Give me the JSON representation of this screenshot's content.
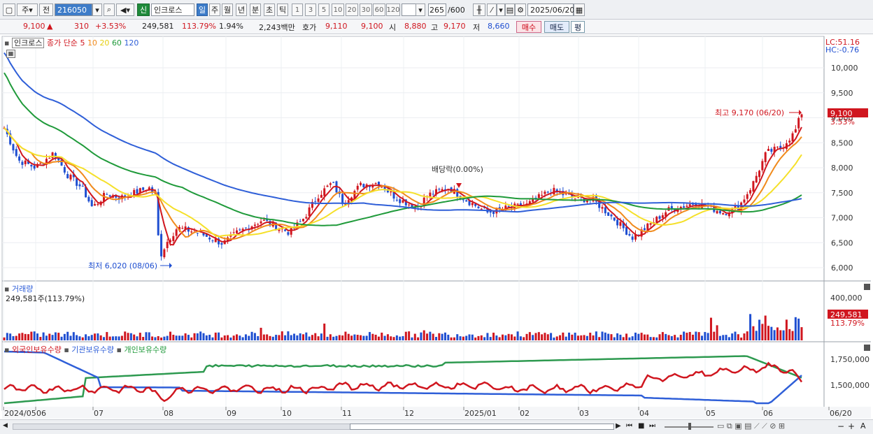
{
  "toolbar": {
    "mode1": "주",
    "mode2": "전",
    "code": "216050",
    "badge": "신",
    "name": "인크로스",
    "periods": [
      "일",
      "주",
      "월",
      "년",
      "분",
      "초",
      "틱"
    ],
    "nums": [
      "1",
      "3",
      "5",
      "10",
      "20",
      "30",
      "60",
      "120"
    ],
    "count": "265",
    "count_total": "/600",
    "date": "2025/06/20"
  },
  "info": {
    "price": "9,100",
    "arrow": "▲",
    "change": "310",
    "change_pct": "+3.53%",
    "volume": "249,581",
    "vol_ratio": "113.79%",
    "turnover": "1.94%",
    "amount": "2,243백만",
    "bid_label": "호가",
    "bid": "9,110",
    "ask": "9,100",
    "open_label": "시",
    "open": "8,880",
    "high_label": "고",
    "high": "9,170",
    "low_label": "저",
    "low": "8,660",
    "buy": "매수",
    "sell": "매도",
    "eval": "평"
  },
  "price_panel": {
    "title": "인크로스",
    "ma_label": "종가 단순",
    "ma": [
      "5",
      "10",
      "20",
      "60",
      "120"
    ],
    "lc": "LC:51.16",
    "hc": "HC:-0.76",
    "yticks": [
      "10,000",
      "9,500",
      "9,000",
      "8,500",
      "8,000",
      "7,500",
      "7,000",
      "6,500",
      "6,000"
    ],
    "current_price": "9,100",
    "current_pct": "3.53%",
    "high_note": "최고 9,170 (06/20)",
    "low_note": "최저 6,020 (08/06)",
    "dividend_note": "배당락(0.00%)"
  },
  "volume_panel": {
    "title": "거래량",
    "value": "249,581주(113.79%)",
    "ytick": "400,000",
    "current": "249,581",
    "current_pct": "113.79%"
  },
  "holding_panel": {
    "series": [
      "외국인보유수량",
      "기관보유수량",
      "개인보유수량"
    ],
    "yticks": [
      "1,750,000",
      "1,500,000"
    ]
  },
  "xaxis": [
    "2024/05",
    "06",
    "07",
    "08",
    "09",
    "10",
    "11",
    "12",
    "2025/01",
    "02",
    "03",
    "04",
    "05",
    "06",
    "06/20"
  ],
  "colors": {
    "ma5": "#d0161f",
    "ma10": "#f08a1c",
    "ma20": "#f5e02a",
    "ma60": "#1f9a3a",
    "ma120": "#2f5fd8"
  }
}
